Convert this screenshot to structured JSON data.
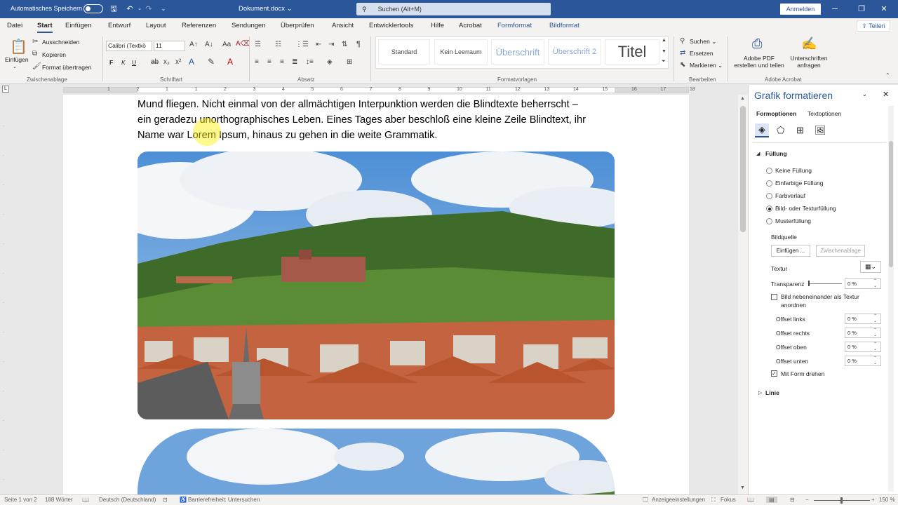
{
  "titlebar": {
    "autosave_label": "Automatisches Speichern",
    "doc_title": "Dokument.docx",
    "search_placeholder": "Suchen (Alt+M)",
    "signin": "Anmelden"
  },
  "tabs": [
    "Datei",
    "Start",
    "Einfügen",
    "Entwurf",
    "Layout",
    "Referenzen",
    "Sendungen",
    "Überprüfen",
    "Ansicht",
    "Entwicklertools",
    "Hilfe",
    "Acrobat",
    "Formformat",
    "Bildformat"
  ],
  "share": "Teilen",
  "ribbon": {
    "clipboard": {
      "paste": "Einfügen",
      "cut": "Ausschneiden",
      "copy": "Kopieren",
      "format_painter": "Format übertragen",
      "label": "Zwischenablage"
    },
    "font": {
      "name": "Calibri (Textkö",
      "size": "11",
      "bold": "F",
      "italic": "K",
      "underline": "U",
      "label": "Schriftart"
    },
    "paragraph": {
      "label": "Absatz"
    },
    "styles": {
      "items": [
        "Standard",
        "Kein Leerraum",
        "Überschrift",
        "Überschrift 2",
        "Titel"
      ],
      "label": "Formatvorlagen"
    },
    "editing": {
      "find": "Suchen",
      "replace": "Ersetzen",
      "select": "Markieren",
      "label": "Bearbeiten"
    },
    "acrobat": {
      "create_pdf": "Adobe PDF\nerstellen und teilen",
      "request_sign": "Unterschriften\nanfragen",
      "label": "Adobe Acrobat"
    }
  },
  "ruler_numbers": [
    "1",
    "2",
    "1",
    "1",
    "2",
    "3",
    "4",
    "5",
    "6",
    "7",
    "8",
    "9",
    "10",
    "11",
    "12",
    "13",
    "14",
    "15",
    "16",
    "17",
    "18"
  ],
  "document": {
    "lines": [
      "Mund fliegen. Nicht einmal von der allmächtigen Interpunktion werden die Blindtexte beherrscht –",
      "ein geradezu unorthographisches Leben. Eines Tages aber beschloß eine kleine Zeile Blindtext, ihr",
      "Name war Lorem Ipsum, hinaus zu gehen in die weite Grammatik."
    ]
  },
  "pane": {
    "title": "Grafik formatieren",
    "tab_shape": "Formoptionen",
    "tab_text": "Textoptionen",
    "section_fill": "Füllung",
    "fill_options": [
      "Keine Füllung",
      "Einfarbige Füllung",
      "Farbverlauf",
      "Bild- oder Texturfüllung",
      "Musterfüllung"
    ],
    "selected_fill": "Bild- oder Texturfüllung",
    "picture_source": "Bildquelle",
    "insert_btn": "Einfügen ...",
    "clipboard_btn": "Zwischenablage",
    "texture": "Textur",
    "transparency": "Transparenz",
    "transparency_value": "0 %",
    "tile_line1": "Bild nebeneinander als Textur",
    "tile_line2": "anordnen",
    "offset_left": "Offset links",
    "offset_right": "Offset rechts",
    "offset_top": "Offset oben",
    "offset_bottom": "Offset unten",
    "offset_left_value": "0 %",
    "offset_right_value": "0 %",
    "offset_top_value": "0 %",
    "offset_bottom_value": "0 %",
    "rotate_with_shape": "Mit Form drehen",
    "rotate_checked": true,
    "section_line": "Linie"
  },
  "status": {
    "page": "Seite 1 von 2",
    "words": "188 Wörter",
    "language": "Deutsch (Deutschland)",
    "accessibility": "Barrierefreiheit: Untersuchen",
    "display_settings": "Anzeigeeinstellungen",
    "focus": "Fokus",
    "zoom": "150 %"
  },
  "colors": {
    "accent": "#2b579a",
    "ribbon_bg": "#f3f2f1"
  }
}
